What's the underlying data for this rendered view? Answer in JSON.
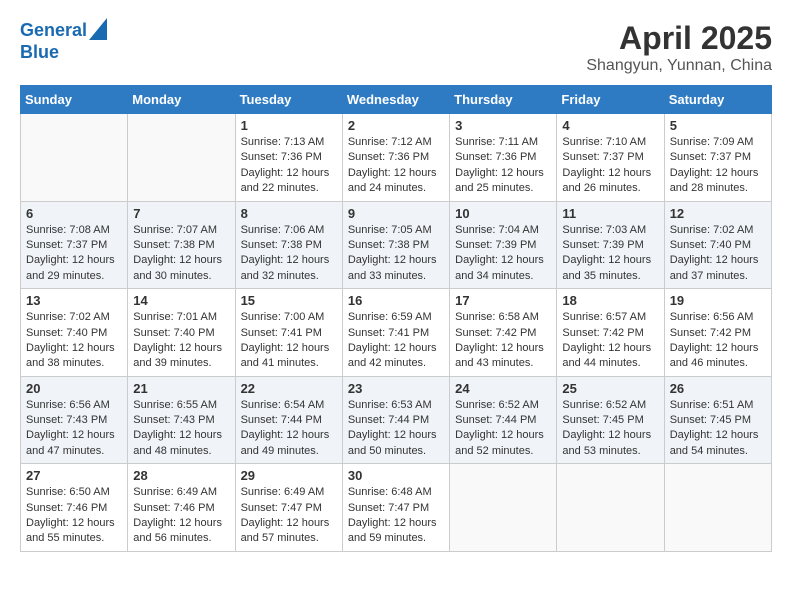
{
  "header": {
    "logo_line1": "General",
    "logo_line2": "Blue",
    "month": "April 2025",
    "location": "Shangyun, Yunnan, China"
  },
  "days_of_week": [
    "Sunday",
    "Monday",
    "Tuesday",
    "Wednesday",
    "Thursday",
    "Friday",
    "Saturday"
  ],
  "weeks": [
    [
      {
        "day": "",
        "empty": true
      },
      {
        "day": "",
        "empty": true
      },
      {
        "day": "1",
        "sunrise": "7:13 AM",
        "sunset": "7:36 PM",
        "daylight": "12 hours and 22 minutes."
      },
      {
        "day": "2",
        "sunrise": "7:12 AM",
        "sunset": "7:36 PM",
        "daylight": "12 hours and 24 minutes."
      },
      {
        "day": "3",
        "sunrise": "7:11 AM",
        "sunset": "7:36 PM",
        "daylight": "12 hours and 25 minutes."
      },
      {
        "day": "4",
        "sunrise": "7:10 AM",
        "sunset": "7:37 PM",
        "daylight": "12 hours and 26 minutes."
      },
      {
        "day": "5",
        "sunrise": "7:09 AM",
        "sunset": "7:37 PM",
        "daylight": "12 hours and 28 minutes."
      }
    ],
    [
      {
        "day": "6",
        "sunrise": "7:08 AM",
        "sunset": "7:37 PM",
        "daylight": "12 hours and 29 minutes."
      },
      {
        "day": "7",
        "sunrise": "7:07 AM",
        "sunset": "7:38 PM",
        "daylight": "12 hours and 30 minutes."
      },
      {
        "day": "8",
        "sunrise": "7:06 AM",
        "sunset": "7:38 PM",
        "daylight": "12 hours and 32 minutes."
      },
      {
        "day": "9",
        "sunrise": "7:05 AM",
        "sunset": "7:38 PM",
        "daylight": "12 hours and 33 minutes."
      },
      {
        "day": "10",
        "sunrise": "7:04 AM",
        "sunset": "7:39 PM",
        "daylight": "12 hours and 34 minutes."
      },
      {
        "day": "11",
        "sunrise": "7:03 AM",
        "sunset": "7:39 PM",
        "daylight": "12 hours and 35 minutes."
      },
      {
        "day": "12",
        "sunrise": "7:02 AM",
        "sunset": "7:40 PM",
        "daylight": "12 hours and 37 minutes."
      }
    ],
    [
      {
        "day": "13",
        "sunrise": "7:02 AM",
        "sunset": "7:40 PM",
        "daylight": "12 hours and 38 minutes."
      },
      {
        "day": "14",
        "sunrise": "7:01 AM",
        "sunset": "7:40 PM",
        "daylight": "12 hours and 39 minutes."
      },
      {
        "day": "15",
        "sunrise": "7:00 AM",
        "sunset": "7:41 PM",
        "daylight": "12 hours and 41 minutes."
      },
      {
        "day": "16",
        "sunrise": "6:59 AM",
        "sunset": "7:41 PM",
        "daylight": "12 hours and 42 minutes."
      },
      {
        "day": "17",
        "sunrise": "6:58 AM",
        "sunset": "7:42 PM",
        "daylight": "12 hours and 43 minutes."
      },
      {
        "day": "18",
        "sunrise": "6:57 AM",
        "sunset": "7:42 PM",
        "daylight": "12 hours and 44 minutes."
      },
      {
        "day": "19",
        "sunrise": "6:56 AM",
        "sunset": "7:42 PM",
        "daylight": "12 hours and 46 minutes."
      }
    ],
    [
      {
        "day": "20",
        "sunrise": "6:56 AM",
        "sunset": "7:43 PM",
        "daylight": "12 hours and 47 minutes."
      },
      {
        "day": "21",
        "sunrise": "6:55 AM",
        "sunset": "7:43 PM",
        "daylight": "12 hours and 48 minutes."
      },
      {
        "day": "22",
        "sunrise": "6:54 AM",
        "sunset": "7:44 PM",
        "daylight": "12 hours and 49 minutes."
      },
      {
        "day": "23",
        "sunrise": "6:53 AM",
        "sunset": "7:44 PM",
        "daylight": "12 hours and 50 minutes."
      },
      {
        "day": "24",
        "sunrise": "6:52 AM",
        "sunset": "7:44 PM",
        "daylight": "12 hours and 52 minutes."
      },
      {
        "day": "25",
        "sunrise": "6:52 AM",
        "sunset": "7:45 PM",
        "daylight": "12 hours and 53 minutes."
      },
      {
        "day": "26",
        "sunrise": "6:51 AM",
        "sunset": "7:45 PM",
        "daylight": "12 hours and 54 minutes."
      }
    ],
    [
      {
        "day": "27",
        "sunrise": "6:50 AM",
        "sunset": "7:46 PM",
        "daylight": "12 hours and 55 minutes."
      },
      {
        "day": "28",
        "sunrise": "6:49 AM",
        "sunset": "7:46 PM",
        "daylight": "12 hours and 56 minutes."
      },
      {
        "day": "29",
        "sunrise": "6:49 AM",
        "sunset": "7:47 PM",
        "daylight": "12 hours and 57 minutes."
      },
      {
        "day": "30",
        "sunrise": "6:48 AM",
        "sunset": "7:47 PM",
        "daylight": "12 hours and 59 minutes."
      },
      {
        "day": "",
        "empty": true
      },
      {
        "day": "",
        "empty": true
      },
      {
        "day": "",
        "empty": true
      }
    ]
  ],
  "labels": {
    "sunrise": "Sunrise:",
    "sunset": "Sunset:",
    "daylight": "Daylight:"
  }
}
